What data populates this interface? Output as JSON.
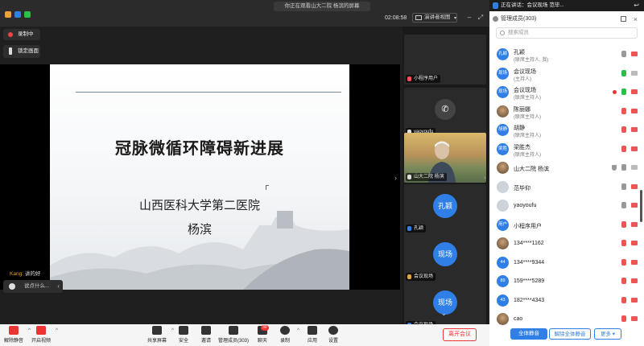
{
  "topbar": {
    "viewing_notice": "你正在观看山大二院 杨滨的屏幕",
    "timer": "02:08:58",
    "view_mode": "演讲者视图"
  },
  "controls": {
    "recording": "录制中",
    "lock_screen": "锁定画面"
  },
  "slide": {
    "title": "冠脉微循环障碍新进展",
    "subtitle": "山西医科大学第二医院",
    "author": "杨滨"
  },
  "chat": {
    "sender": "Kang:",
    "message": "讲的好",
    "input_placeholder": "说点什么..."
  },
  "videos": [
    {
      "label": "小程序用户"
    },
    {
      "label": "yaoyoufu"
    },
    {
      "label": "山大二院 杨滨"
    },
    {
      "label": "孔颖",
      "bubble": "孔颖"
    },
    {
      "label": "会议现场",
      "bubble": "现场"
    },
    {
      "label": "会议现场",
      "bubble": "现场"
    }
  ],
  "panel": {
    "speaking_now": "正在讲话：会议现场",
    "speaking_more": "范毕...",
    "title": "管理成员(303)",
    "search_placeholder": "搜索成员",
    "participants": [
      {
        "avatar": "孔颖",
        "name": "孔颖",
        "role": "(联席主持人, 我)"
      },
      {
        "avatar": "现场",
        "name": "会议现场",
        "role": "(主持人)"
      },
      {
        "avatar": "现场",
        "name": "会议现场",
        "role": "(联席主持人)"
      },
      {
        "avatar": "",
        "name": "陈丽娜",
        "role": "(联席主持人)"
      },
      {
        "avatar": "胡静",
        "name": "胡静",
        "role": "(联席主持人)"
      },
      {
        "avatar": "梁胜杰",
        "name": "梁胜杰",
        "role": "(联席主持人)"
      },
      {
        "avatar": "",
        "name": "山大二院 杨滨",
        "role": ""
      },
      {
        "avatar": "",
        "name": "范毕仰",
        "role": ""
      },
      {
        "avatar": "",
        "name": "yaoyoufu",
        "role": ""
      },
      {
        "avatar": "用户",
        "name": "小程序用户",
        "role": ""
      },
      {
        "avatar": "",
        "name": "134****1162",
        "role": ""
      },
      {
        "avatar": "44",
        "name": "134****9344",
        "role": ""
      },
      {
        "avatar": "89",
        "name": "159****5289",
        "role": ""
      },
      {
        "avatar": "43",
        "name": "182****4343",
        "role": ""
      },
      {
        "avatar": "",
        "name": "cao",
        "role": ""
      }
    ],
    "mute_all": "全体静音",
    "unmute_all": "解除全体静音",
    "more": "更多"
  },
  "toolbar": {
    "unmute": "解除静音",
    "start_video": "开启视频",
    "share_screen": "共享屏幕",
    "security": "安全",
    "invite": "邀请",
    "manage_members": "管理成员(303)",
    "chat": "聊天",
    "chat_badge": "30",
    "record": "录制",
    "apps": "应用",
    "settings": "设置",
    "leave": "离开会议"
  }
}
